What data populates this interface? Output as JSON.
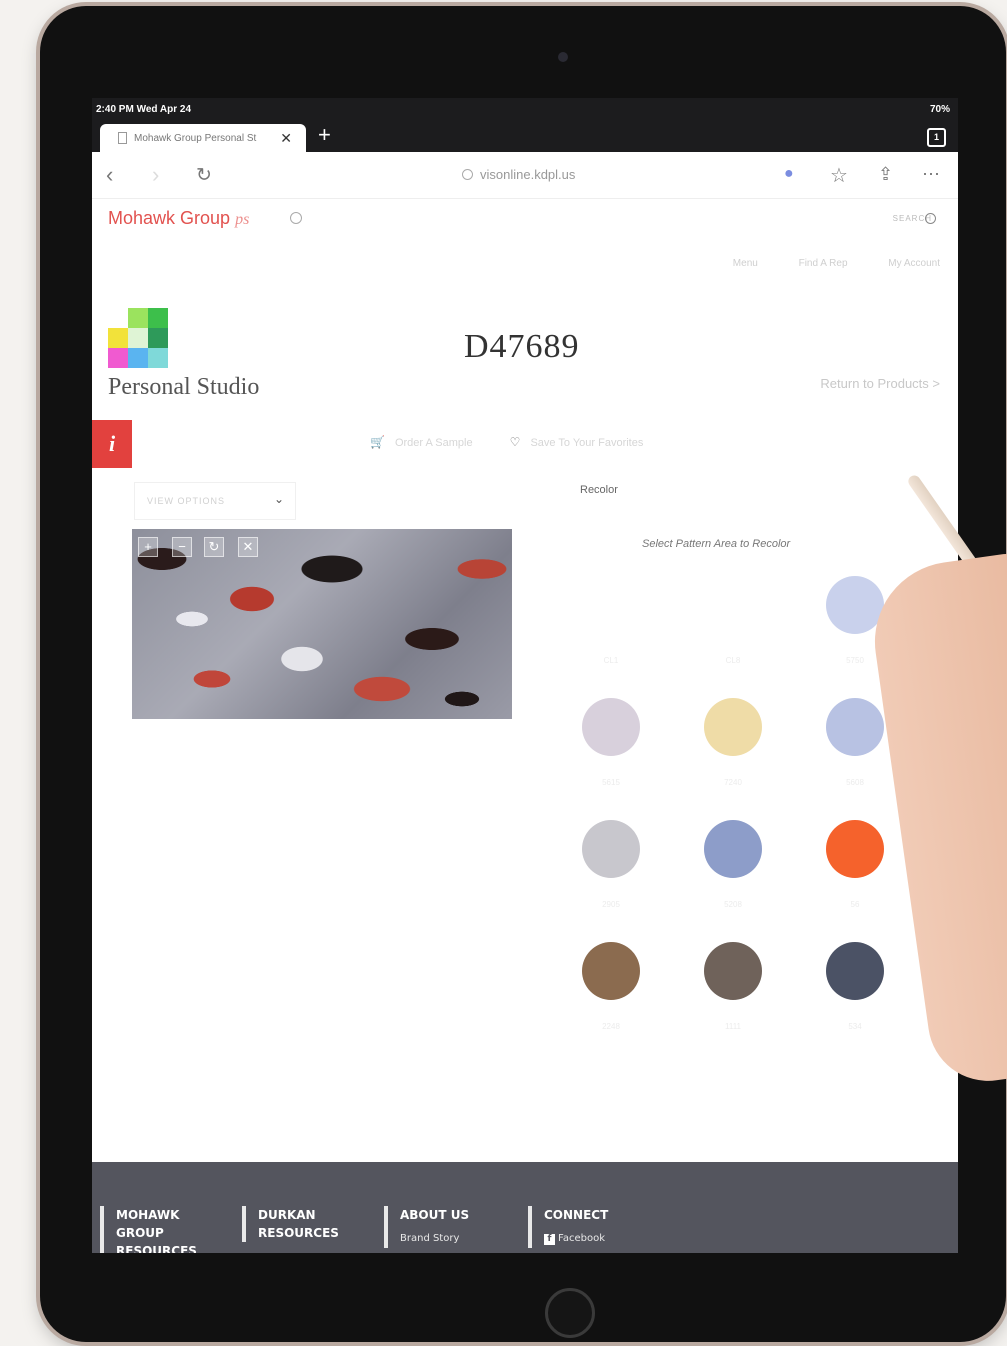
{
  "status_bar": {
    "time": "2:40 PM  Wed Apr 24",
    "battery": "70%"
  },
  "tab": {
    "title": "Mohawk Group Personal St",
    "count": "1"
  },
  "toolbar": {
    "url": "visonline.kdpl.us"
  },
  "site": {
    "brand": "Mohawk Group",
    "brand_suffix": "ps",
    "search_label": "SEARCH",
    "util_links": [
      "Menu",
      "Find A Rep",
      "My Account"
    ],
    "studio_title": "Personal Studio",
    "product_code": "D47689",
    "return_link": "Return to Products >",
    "info_badge": "i",
    "order_sample": "Order A Sample",
    "save_favorites": "Save To Your Favorites",
    "view_options": "VIEW OPTIONS"
  },
  "recolor": {
    "label": "Recolor",
    "hint": "Select Pattern Area to Recolor",
    "swatches": [
      {
        "code": "CL1",
        "color": "#ffffff"
      },
      {
        "code": "CL8",
        "color": "#ffffff"
      },
      {
        "code": "5750",
        "color": "#c9d1ec"
      },
      {
        "code": "5615",
        "color": "#d8d0dc"
      },
      {
        "code": "7240",
        "color": "#efdca7"
      },
      {
        "code": "5608",
        "color": "#b8c2e3"
      },
      {
        "code": "2905",
        "color": "#c8c7cd"
      },
      {
        "code": "5208",
        "color": "#8d9dc9"
      },
      {
        "code": "56",
        "color": "#f5622c"
      },
      {
        "code": "2248",
        "color": "#8b6b4f"
      },
      {
        "code": "1111",
        "color": "#6f625a"
      },
      {
        "code": "534",
        "color": "#4b5265"
      }
    ]
  },
  "footer": {
    "col1": "MOHAWK GROUP RESOURCES",
    "col2": "DURKAN RESOURCES",
    "col3": "ABOUT US",
    "col3_sub": "Brand Story",
    "col4": "CONNECT",
    "col4_sub": "Facebook"
  },
  "colors": {
    "accent": "#e2413e",
    "footer_bg": "#54555e"
  }
}
